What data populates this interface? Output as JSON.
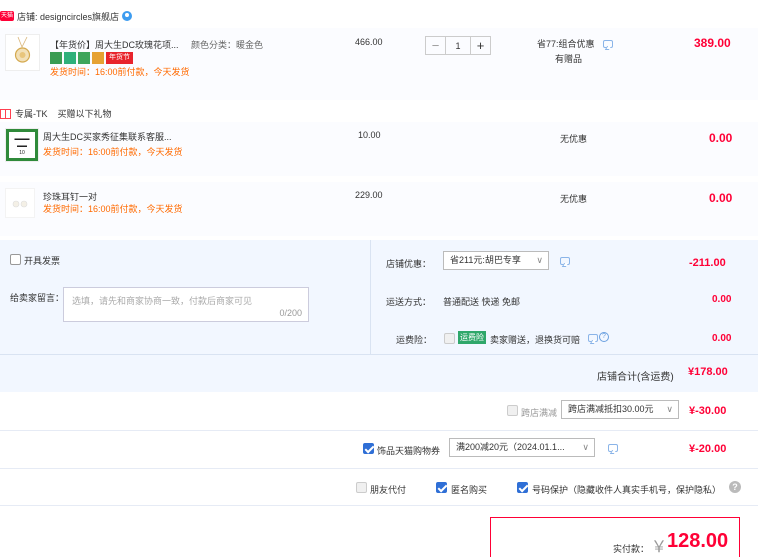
{
  "store": {
    "badge": "天猫",
    "label": "店铺: designcircles旗舰店"
  },
  "items": [
    {
      "title": "【年货价】周大生DC玫瑰花项...",
      "spec": "颜色分类：暖金色",
      "ship": "发货时间：16:00前付款，今天发货",
      "unit_price": "466.00",
      "qty": "1",
      "promo": "省77:组合优惠",
      "promo2": "有赠品",
      "total": "389.00",
      "festival_tag": "年货节"
    },
    {
      "title": "周大生DC买家秀征集联系客服...",
      "ship": "发货时间：16:00前付款，今天发货",
      "unit_price": "10.00",
      "promo": "无优惠",
      "total": "0.00"
    },
    {
      "title": "珍珠耳钉一对",
      "ship": "发货时间：16:00前付款，今天发货",
      "unit_price": "229.00",
      "promo": "无优惠",
      "total": "0.00"
    }
  ],
  "gift_header": {
    "name": "专属-TK",
    "desc": "买赠以下礼物"
  },
  "invoice": {
    "label": "开具发票"
  },
  "message": {
    "label": "给卖家留言：",
    "placeholder": "选填，请先和商家协商一致，付款后商家可见",
    "counter": "0/200"
  },
  "store_discount": {
    "label": "店铺优惠：",
    "select": "省211元:胡巴专享",
    "amount": "-211.00"
  },
  "shipping": {
    "label": "运送方式：",
    "value": "普通配送 快递 免邮",
    "amount": "0.00"
  },
  "insurance": {
    "label": "运费险：",
    "badge": "运费险",
    "value": "卖家赠送，退换货可赔",
    "amount": "0.00"
  },
  "store_total": {
    "label": "店铺合计(含运费)",
    "amount": "¥178.00"
  },
  "cross_store": {
    "label": "跨店满减",
    "select": "跨店满减抵扣30.00元",
    "amount": "¥-30.00"
  },
  "coupon": {
    "label": "饰品天猫购物券",
    "select": "满200减20元（2024.01.1...",
    "amount": "¥-20.00"
  },
  "options": {
    "friend_pay": "朋友代付",
    "anonymous": "匿名购买",
    "privacy": "号码保护（隐藏收件人真实手机号，保护隐私）"
  },
  "pay": {
    "label": "实付款：",
    "currency": "￥",
    "amount": "128.00"
  },
  "colors": {
    "accent_red": "#ff0036",
    "ship_orange": "#ff6a00",
    "checkbox_blue": "#2f6fd6"
  }
}
